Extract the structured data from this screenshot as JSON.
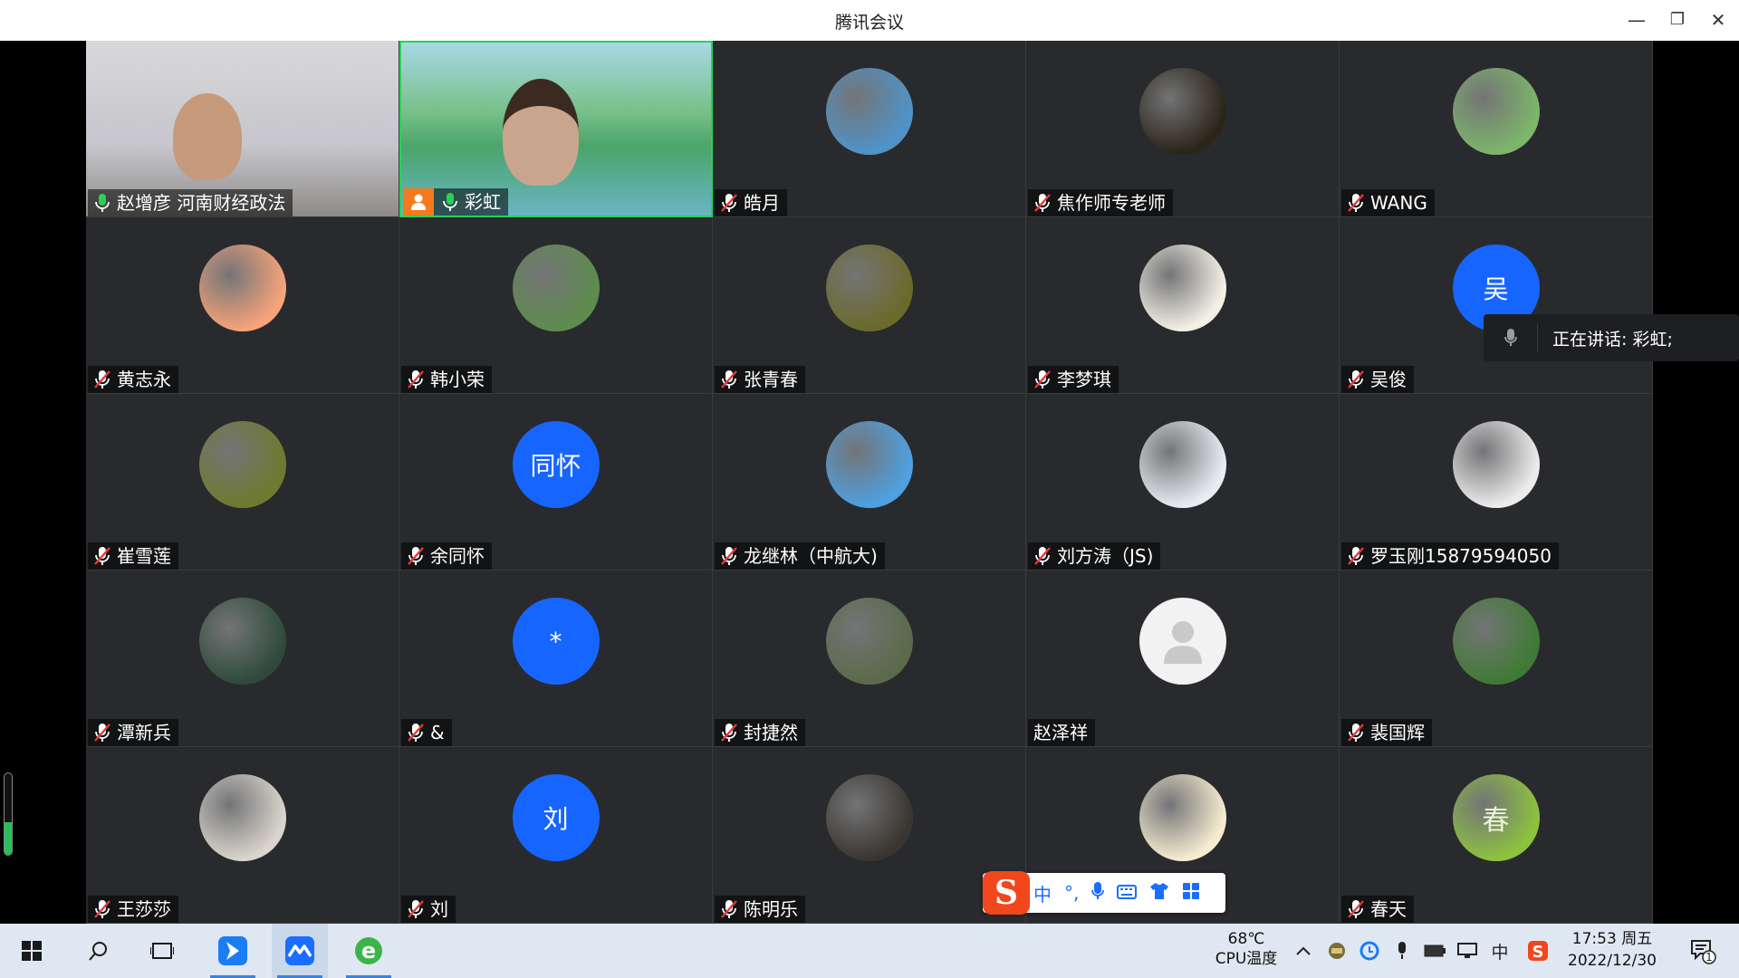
{
  "window": {
    "title": "腾讯会议",
    "minimize_glyph": "—",
    "restore_glyph": "❐",
    "close_glyph": "✕"
  },
  "participants": [
    {
      "name": "赵增彦 河南财经政法",
      "mic": "on",
      "kind": "video"
    },
    {
      "name": "彩虹",
      "mic": "on",
      "kind": "video",
      "host": true,
      "speaking": true
    },
    {
      "name": "皓月",
      "mic": "off",
      "kind": "image",
      "avatar_color": "#4f93c9"
    },
    {
      "name": "焦作师专老师",
      "mic": "off",
      "kind": "image",
      "avatar_color": "#2b2418"
    },
    {
      "name": "WANG",
      "mic": "off",
      "kind": "image",
      "avatar_color": "#7db56a"
    },
    {
      "name": "黄志永",
      "mic": "off",
      "kind": "image",
      "avatar_color": "#f6a37a"
    },
    {
      "name": "韩小荣",
      "mic": "off",
      "kind": "image",
      "avatar_color": "#5d8c4e"
    },
    {
      "name": "张青春",
      "mic": "off",
      "kind": "image",
      "avatar_color": "#6b6a2a"
    },
    {
      "name": "李梦琪",
      "mic": "off",
      "kind": "image",
      "avatar_color": "#f4f0e6"
    },
    {
      "name": "吴俊",
      "mic": "off",
      "kind": "text",
      "avatar_text": "吴"
    },
    {
      "name": "崔雪莲",
      "mic": "off",
      "kind": "image",
      "avatar_color": "#6e7a2e"
    },
    {
      "name": "余同怀",
      "mic": "off",
      "kind": "text",
      "avatar_text": "同怀"
    },
    {
      "name": "龙继林（中航大)",
      "mic": "off",
      "kind": "image",
      "avatar_color": "#4ea0e0"
    },
    {
      "name": "刘方涛（JS)",
      "mic": "off",
      "kind": "image",
      "avatar_color": "#e8ecf2"
    },
    {
      "name": "罗玉刚15879594050",
      "mic": "off",
      "kind": "image",
      "avatar_color": "#ececec"
    },
    {
      "name": "潭新兵",
      "mic": "off",
      "kind": "image",
      "avatar_color": "#2f4a3c"
    },
    {
      "name": "&",
      "mic": "off",
      "kind": "text",
      "avatar_text": "*"
    },
    {
      "name": "封捷然",
      "mic": "off",
      "kind": "image",
      "avatar_color": "#5b6a4a"
    },
    {
      "name": "赵泽祥",
      "mic": "none",
      "kind": "placeholder"
    },
    {
      "name": "裴国辉",
      "mic": "off",
      "kind": "image",
      "avatar_color": "#3f7a34"
    },
    {
      "name": "王莎莎",
      "mic": "off",
      "kind": "image",
      "avatar_color": "#d9d4cc"
    },
    {
      "name": "刘",
      "mic": "off",
      "kind": "text",
      "avatar_text": "刘"
    },
    {
      "name": "陈明乐",
      "mic": "off",
      "kind": "image",
      "avatar_color": "#3a3530"
    },
    {
      "name": "",
      "mic": "none",
      "kind": "image",
      "avatar_color": "#f5ecd0"
    },
    {
      "name": "春天",
      "mic": "off",
      "kind": "image",
      "avatar_color": "#8cc23e",
      "avatar_text": "春"
    }
  ],
  "speaking_popup": {
    "label": "正在讲话: 彩虹;"
  },
  "volume_meter": {
    "level": 0.4
  },
  "ime_toolbar": {
    "logo": "S",
    "mode": "中",
    "punct": "°,"
  },
  "taskbar": {
    "temperature": "68℃",
    "temperature_label": "CPU温度",
    "ime_indicator": "中",
    "time": "17:53 周五",
    "date": "2022/12/30",
    "notification_count": "1"
  },
  "colors": {
    "accent_blue": "#1665ff",
    "mic_on_green": "#2ad157",
    "mic_off_red": "#e23a3a",
    "host_orange": "#f37a1d"
  }
}
